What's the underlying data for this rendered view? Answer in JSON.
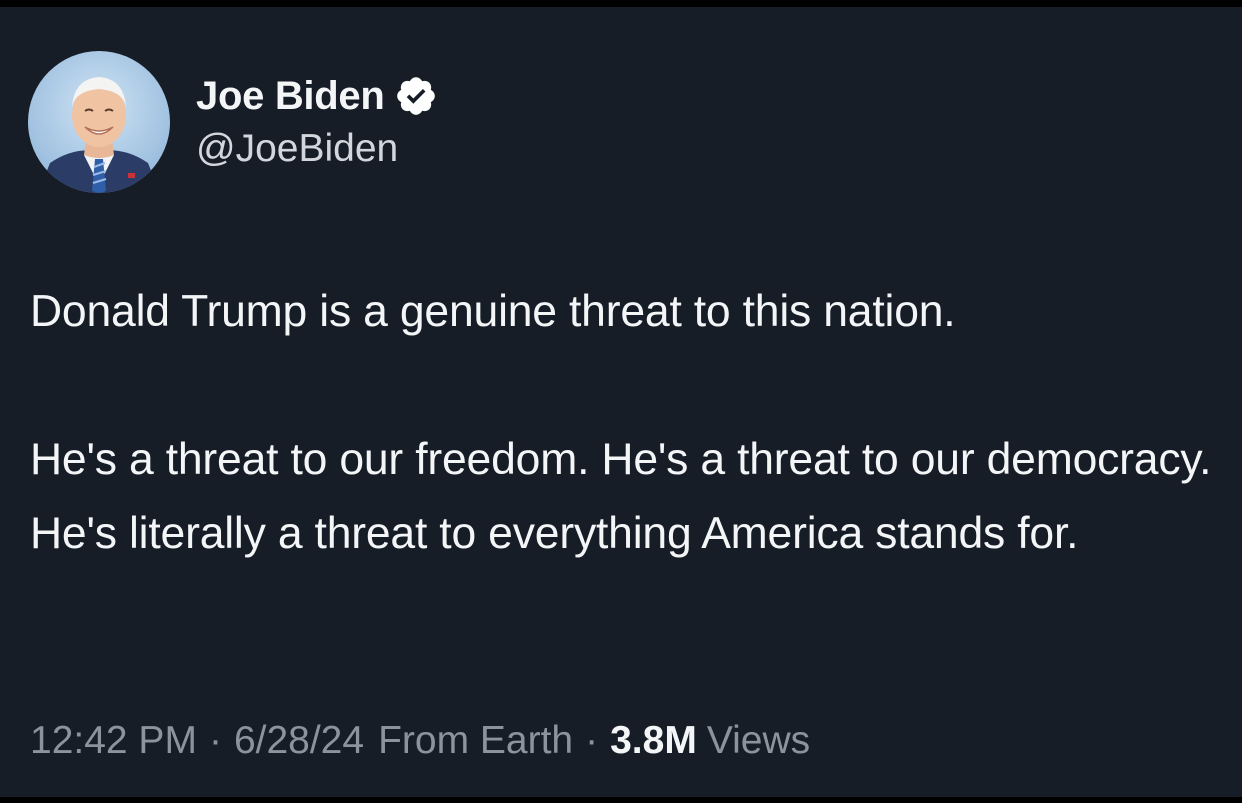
{
  "author": {
    "display_name": "Joe Biden",
    "handle": "@JoeBiden",
    "verified_icon": "verified-badge-icon",
    "badge_color": "#ffffff"
  },
  "tweet": {
    "paragraph_1": "Donald Trump is a genuine threat to this nation.",
    "paragraph_2": "He's a threat to our freedom. He's a threat to our democracy. He's literally a threat to everything America stands for."
  },
  "meta": {
    "time": "12:42 PM",
    "separator": "·",
    "date": "6/28/24",
    "source": "From Earth",
    "views_count": "3.8M",
    "views_label": "Views"
  },
  "colors": {
    "background": "#161d27",
    "text_primary": "#f3f5f7",
    "text_secondary": "#8b939d"
  }
}
